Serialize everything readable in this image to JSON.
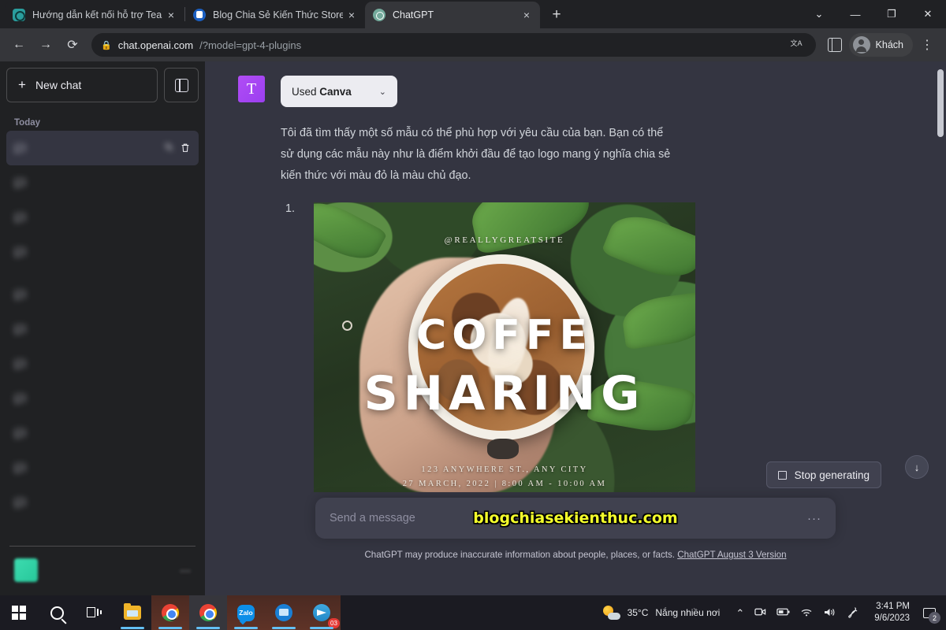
{
  "browser": {
    "tabs": [
      {
        "title": "Hướng dẫn kết nối hỗ trợ Teamvi",
        "favicon": "teamviewer-icon",
        "close": "×",
        "active": false
      },
      {
        "title": "Blog Chia Sẻ Kiến Thức Store - Sh",
        "favicon": "blog-icon",
        "close": "×",
        "active": false
      },
      {
        "title": "ChatGPT",
        "favicon": "chatgpt-icon",
        "close": "×",
        "active": true
      }
    ],
    "new_tab_label": "+",
    "window_controls": {
      "minimize_group": "⌄",
      "minimize": "—",
      "maximize": "❐",
      "close": "✕"
    },
    "toolbar": {
      "back": "←",
      "forward": "→",
      "reload": "⟳",
      "lock": "🔒",
      "url_host": "chat.openai.com",
      "url_path": "/?model=gpt-4-plugins",
      "translate": "文A",
      "profile_name": "Khách",
      "menu": "⋮"
    }
  },
  "sidebar": {
    "new_chat_label": "New chat",
    "new_chat_plus": "+",
    "section_today": "Today",
    "section_yesterday": "",
    "items": [
      {
        "label": "",
        "active": true
      },
      {
        "label": "",
        "active": false
      },
      {
        "label": "",
        "active": false
      },
      {
        "label": "",
        "active": false
      }
    ],
    "items_yesterday": [
      {
        "label": ""
      },
      {
        "label": ""
      },
      {
        "label": ""
      },
      {
        "label": ""
      },
      {
        "label": ""
      },
      {
        "label": ""
      },
      {
        "label": ""
      }
    ],
    "user_email": ""
  },
  "conversation": {
    "plugin_badge_letter": "T",
    "used_plugin_prefix": "Used ",
    "used_plugin_name": "Canva",
    "used_plugin_chevron": "⌄",
    "assistant_text": "Tôi đã tìm thấy một số mẫu có thể phù hợp với yêu cầu của bạn. Bạn có thể sử dụng các mẫu này như là điểm khởi đầu để tạo logo mang ý nghĩa chia sẻ kiến thức với màu đỏ là màu chủ đạo.",
    "list_number": "1.",
    "poster": {
      "handle": "@REALLYGREATSITE",
      "title_line1": "COFFE",
      "title_line2": "SHARING",
      "address": "123 ANYWHERE ST., ANY CITY",
      "date": "27 MARCH, 2022 | 8:00 AM - 10:00 AM"
    }
  },
  "controls": {
    "stop_generating": "Stop generating",
    "scroll_down_icon": "↓",
    "help_icon": "?"
  },
  "composer": {
    "placeholder": "Send a message",
    "more_icon": "···",
    "watermark": "blogchiasekienthuc.com",
    "disclaimer_text": "ChatGPT may produce inaccurate information about people, places, or facts. ",
    "disclaimer_link": "ChatGPT August 3 Version"
  },
  "taskbar": {
    "start": "start-icon",
    "search": "search-icon",
    "task_view": "task-view-icon",
    "apps": [
      {
        "name": "file-explorer",
        "badge": ""
      },
      {
        "name": "chrome-profile",
        "badge": ""
      },
      {
        "name": "chrome",
        "badge": ""
      },
      {
        "name": "zalo",
        "label": "Zalo",
        "badge": ""
      },
      {
        "name": "ultraviewer",
        "badge": ""
      },
      {
        "name": "telegram",
        "badge": "03"
      }
    ],
    "weather_temp": "35°C",
    "weather_desc": "Nắng nhiều nơi",
    "tray_chevron": "⌃",
    "time": "3:41 PM",
    "date": "9/6/2023",
    "notification_count": "2"
  }
}
